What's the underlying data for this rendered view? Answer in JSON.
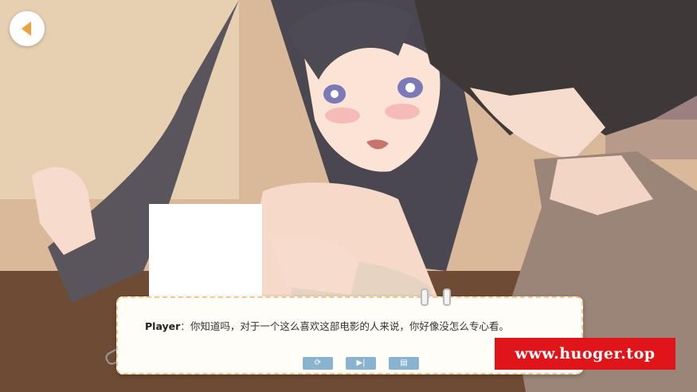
{
  "navigation": {
    "back_icon": "arrow-left-icon"
  },
  "dialog": {
    "speaker": "Player",
    "separator": "：",
    "text": "你知道吗，对于一个这么喜欢这部电影的人来说，你好像没怎么专心看。",
    "controls": [
      {
        "name": "auto-play-button",
        "icon": "refresh-icon",
        "glyph": "⟳"
      },
      {
        "name": "skip-button",
        "icon": "skip-forward-icon",
        "glyph": "▶|"
      },
      {
        "name": "log-button",
        "icon": "document-icon",
        "glyph": "▤"
      }
    ]
  },
  "watermark": {
    "text": "www.huoger.top"
  },
  "colors": {
    "dialog_border": "#f2c98a",
    "control_button": "#8ab3cf",
    "watermark_bg": "#e0151a",
    "back_arrow": "#f0a23a"
  }
}
